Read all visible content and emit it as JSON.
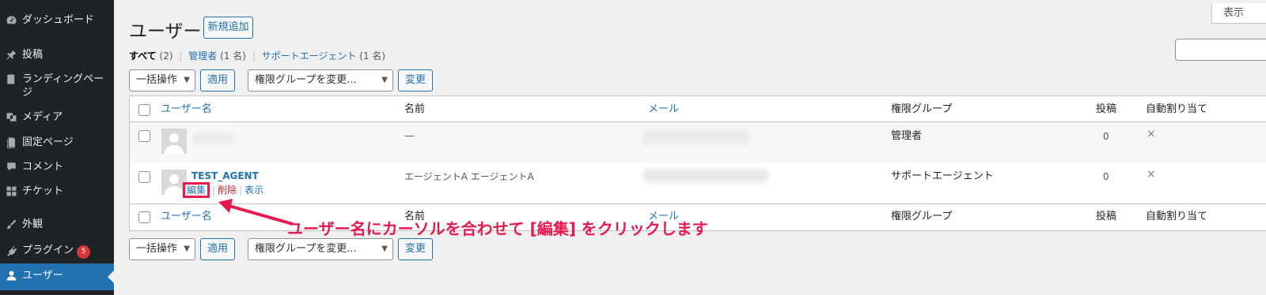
{
  "sidebar": {
    "items": [
      {
        "label": "ダッシュボード",
        "icon": "dashboard-icon"
      },
      {
        "label": "投稿",
        "icon": "pin-icon"
      },
      {
        "label": "ランディングページ",
        "icon": "book-icon"
      },
      {
        "label": "メディア",
        "icon": "media-icon"
      },
      {
        "label": "固定ページ",
        "icon": "page-icon"
      },
      {
        "label": "コメント",
        "icon": "comment-icon"
      },
      {
        "label": "チケット",
        "icon": "grid-icon"
      },
      {
        "label": "外観",
        "icon": "brush-icon"
      },
      {
        "label": "プラグイン",
        "icon": "plugin-icon",
        "badge": "5"
      },
      {
        "label": "ユーザー",
        "icon": "user-icon"
      }
    ],
    "accent": "#2271b1"
  },
  "header": {
    "title": "ユーザー",
    "add_new": "新規追加",
    "screen_options": "表示"
  },
  "filters": {
    "all_label": "すべて",
    "all_count": "(2)",
    "admin_label": "管理者",
    "admin_count": "(1 名)",
    "agent_label": "サポートエージェント",
    "agent_count": "(1 名)",
    "separator": "|"
  },
  "bulk": {
    "action_label": "一括操作",
    "apply": "適用",
    "role_label": "権限グループを変更...",
    "change": "変更"
  },
  "table": {
    "columns": {
      "username": "ユーザー名",
      "name": "名前",
      "email": "メール",
      "role": "権限グループ",
      "posts": "投稿",
      "auto_assign": "自動割り当て"
    },
    "rows": [
      {
        "username": "",
        "name": "—",
        "email": "",
        "role": "管理者",
        "posts": "0",
        "auto_assign": "×"
      },
      {
        "username": "TEST_AGENT",
        "name": "エージェントA エージェントA",
        "email": "",
        "role": "サポートエージェント",
        "posts": "0",
        "auto_assign": "×",
        "actions": {
          "edit": "編集",
          "delete": "削除",
          "view": "表示"
        }
      }
    ]
  },
  "annotation": {
    "text": "ユーザー名にカーソルを合わせて [編集] をクリックします",
    "color": "#e8194f"
  }
}
